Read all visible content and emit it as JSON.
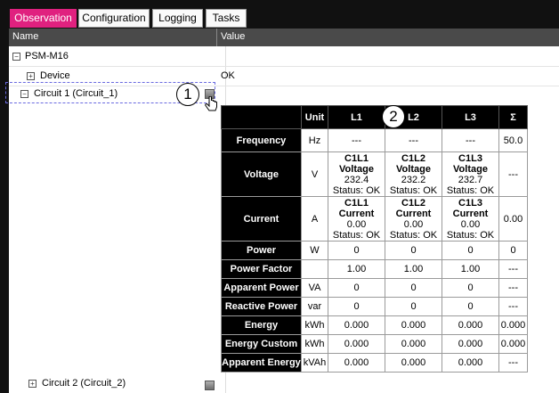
{
  "tabs": [
    {
      "label": "Observation",
      "active": true
    },
    {
      "label": "Configuration",
      "active": false
    },
    {
      "label": "Logging",
      "active": false
    },
    {
      "label": "Tasks",
      "active": false
    }
  ],
  "header": {
    "name": "Name",
    "value": "Value"
  },
  "tree": {
    "root": {
      "label": "PSM-M16",
      "expander": "−"
    },
    "device": {
      "label": "Device",
      "expander": "+",
      "value": "OK"
    },
    "circuit1": {
      "label": "Circuit 1 (Circuit_1)",
      "expander": "−"
    },
    "circuit2": {
      "label": "Circuit 2 (Circuit_2)",
      "expander": "+"
    }
  },
  "callouts": {
    "one": "1",
    "two": "2"
  },
  "table": {
    "columns": [
      "",
      "Unit",
      "L1",
      "L2",
      "L3",
      "Σ"
    ],
    "rows": [
      {
        "name": "Frequency",
        "unit": "Hz",
        "l1": [
          "---"
        ],
        "l2": [
          "---"
        ],
        "l3": [
          "---"
        ],
        "sum": "50.0"
      },
      {
        "name": "Voltage",
        "unit": "V",
        "l1": [
          "C1L1 Voltage",
          "232.4",
          "Status: OK"
        ],
        "l2": [
          "C1L2 Voltage",
          "232.2",
          "Status: OK"
        ],
        "l3": [
          "C1L3 Voltage",
          "232.7",
          "Status: OK"
        ],
        "sum": "---"
      },
      {
        "name": "Current",
        "unit": "A",
        "l1": [
          "C1L1 Current",
          "0.00",
          "Status: OK"
        ],
        "l2": [
          "C1L2 Current",
          "0.00",
          "Status: OK"
        ],
        "l3": [
          "C1L3 Current",
          "0.00",
          "Status: OK"
        ],
        "sum": "0.00"
      },
      {
        "name": "Power",
        "unit": "W",
        "l1": [
          "0"
        ],
        "l2": [
          "0"
        ],
        "l3": [
          "0"
        ],
        "sum": "0"
      },
      {
        "name": "Power Factor",
        "unit": "",
        "l1": [
          "1.00"
        ],
        "l2": [
          "1.00"
        ],
        "l3": [
          "1.00"
        ],
        "sum": "---"
      },
      {
        "name": "Apparent Power",
        "unit": "VA",
        "l1": [
          "0"
        ],
        "l2": [
          "0"
        ],
        "l3": [
          "0"
        ],
        "sum": "---"
      },
      {
        "name": "Reactive Power",
        "unit": "var",
        "l1": [
          "0"
        ],
        "l2": [
          "0"
        ],
        "l3": [
          "0"
        ],
        "sum": "---"
      },
      {
        "name": "Energy",
        "unit": "kWh",
        "l1": [
          "0.000"
        ],
        "l2": [
          "0.000"
        ],
        "l3": [
          "0.000"
        ],
        "sum": "0.000"
      },
      {
        "name": "Energy Custom",
        "unit": "kWh",
        "l1": [
          "0.000"
        ],
        "l2": [
          "0.000"
        ],
        "l3": [
          "0.000"
        ],
        "sum": "0.000"
      },
      {
        "name": "Apparent Energy",
        "unit": "kVAh",
        "l1": [
          "0.000"
        ],
        "l2": [
          "0.000"
        ],
        "l3": [
          "0.000"
        ],
        "sum": "---"
      }
    ]
  },
  "colors": {
    "active_tab": "#e0217f",
    "frame": "#111111",
    "header": "#4a4a4a",
    "selection": "#6a6ae0"
  }
}
